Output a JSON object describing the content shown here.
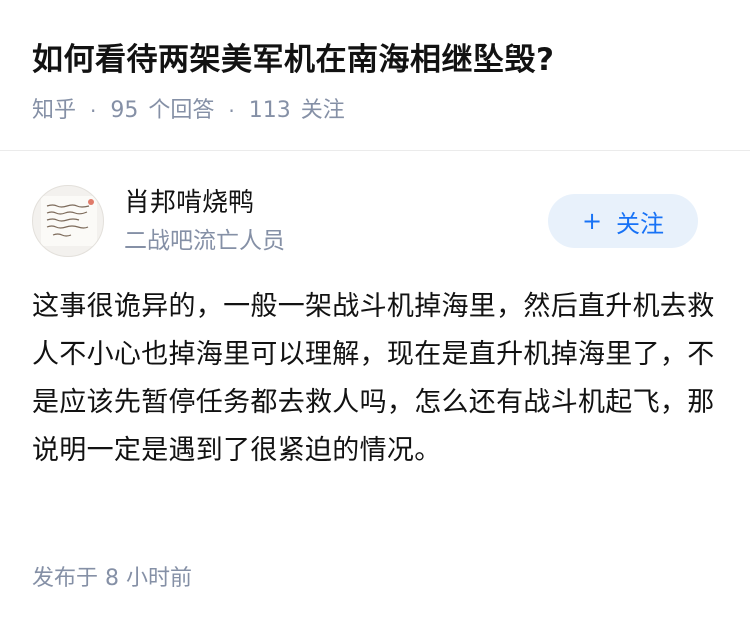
{
  "question": {
    "title": "如何看待两架美军机在南海相继坠毁?",
    "source": "知乎",
    "separator": "·",
    "answer_count": "95",
    "answer_label": "个回答",
    "follower_count": "113",
    "follower_label": "关注"
  },
  "answer": {
    "author": {
      "name": "肖邦啃烧鸭",
      "bio": "二战吧流亡人员",
      "avatar_icon": "handwritten-note-avatar"
    },
    "follow_button": {
      "plus": "+",
      "label": "关注"
    },
    "content": "这事很诡异的，一般一架战斗机掉海里，然后直升机去救人不小心也掉海里可以理解，现在是直升机掉海里了，不是应该先暂停任务都去救人吗，怎么还有战斗机起飞，那说明一定是遇到了很紧迫的情况。",
    "published": "发布于 8 小时前"
  },
  "colors": {
    "text_primary": "#121212",
    "text_secondary": "#8590a6",
    "accent": "#1772f6",
    "follow_bg": "#e8f1fb"
  }
}
